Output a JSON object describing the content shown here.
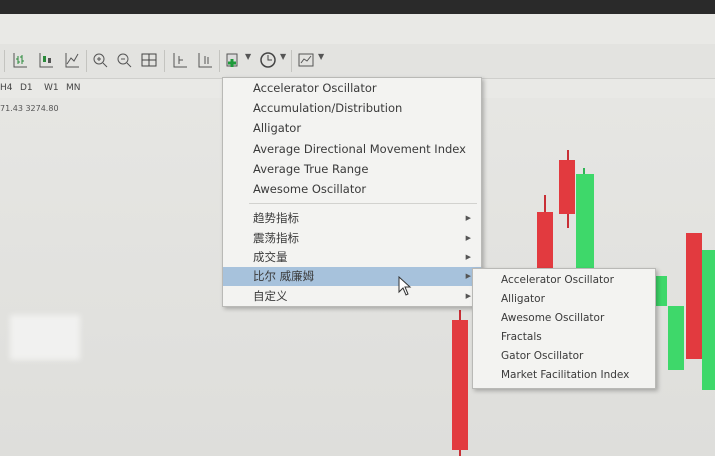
{
  "timeframes": [
    "H4",
    "D1",
    "W1",
    "MN"
  ],
  "price_text": "71.43 3274.80",
  "toolbar": {
    "icons": [
      "bar-chart-icon",
      "candlestick-icon",
      "line-chart-icon",
      "zoom-in-icon",
      "zoom-out-icon",
      "tile-windows-icon",
      "chart-shift-icon",
      "autoscroll-icon",
      "indicators-icon",
      "periods-icon",
      "templates-icon"
    ]
  },
  "indicators_menu": {
    "items": [
      "Accelerator Oscillator",
      "Accumulation/Distribution",
      "Alligator",
      "Average Directional Movement Index",
      "Average True Range",
      "Awesome Oscillator"
    ],
    "categories": [
      "趋势指标",
      "震荡指标",
      "成交量",
      "比尔 威廉姆",
      "自定义"
    ],
    "highlighted": "比尔 威廉姆"
  },
  "bill_williams_submenu": {
    "items": [
      "Accelerator Oscillator",
      "Alligator",
      "Awesome Oscillator",
      "Fractals",
      "Gator Oscillator",
      "Market Facilitation Index"
    ]
  },
  "colors": {
    "bull": "#3ed86a",
    "bear": "#e23a3f",
    "highlight": "#a7c2dc",
    "menu_bg": "#f3f3f1"
  }
}
